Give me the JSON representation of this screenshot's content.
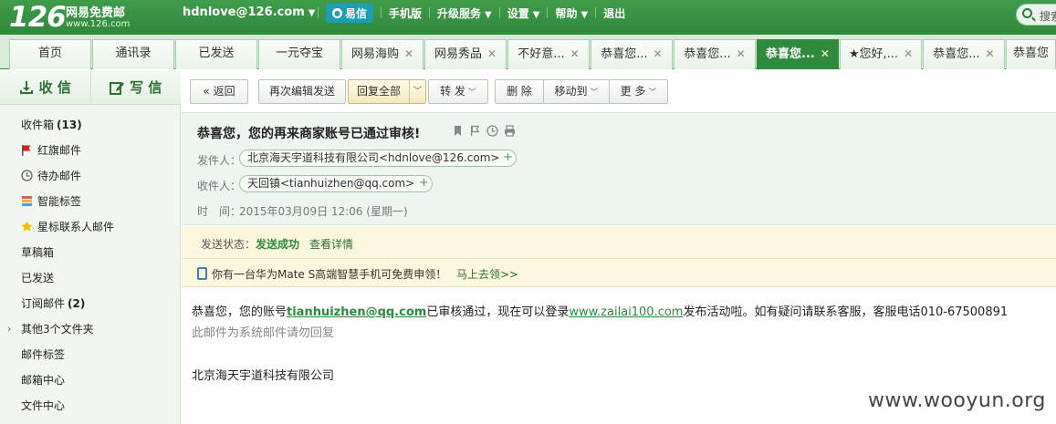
{
  "brand": {
    "logo": "126",
    "name": "网易免费邮",
    "url": "www.126.com"
  },
  "user": {
    "email": "hdnlove@126.com"
  },
  "topnav": {
    "yixin": "易信",
    "mobile": "手机版",
    "upgrade": "升级服务",
    "settings": "设置",
    "help": "帮助",
    "logout": "退出"
  },
  "search": {
    "placeholder": "搜索"
  },
  "tabs": [
    {
      "label": "首页"
    },
    {
      "label": "通讯录"
    },
    {
      "label": "已发送"
    },
    {
      "label": "一元夺宝"
    },
    {
      "label": "网易海购"
    },
    {
      "label": "网易秀品"
    },
    {
      "label": "不好意..."
    },
    {
      "label": "恭喜您..."
    },
    {
      "label": "恭喜您..."
    },
    {
      "label": "恭喜您..."
    },
    {
      "label": "★您好,..."
    },
    {
      "label": "恭喜您..."
    },
    {
      "label": "恭喜您"
    }
  ],
  "sidebar": {
    "receive": "收 信",
    "compose": "写 信",
    "folders": [
      {
        "label": "收件箱",
        "count": "(13)"
      },
      {
        "label": "红旗邮件"
      },
      {
        "label": "待办邮件"
      },
      {
        "label": "智能标签"
      },
      {
        "label": "星标联系人邮件"
      },
      {
        "label": "草稿箱"
      },
      {
        "label": "已发送"
      },
      {
        "label": "订阅邮件",
        "count": "(2)"
      },
      {
        "label": "其他3个文件夹"
      },
      {
        "label": "邮件标签"
      },
      {
        "label": "邮箱中心"
      },
      {
        "label": "文件中心"
      }
    ]
  },
  "toolbar": {
    "back": "返回",
    "reedit": "再次编辑发送",
    "reply_all": "回复全部",
    "forward": "转 发",
    "delete": "删 除",
    "move": "移动到",
    "more": "更 多"
  },
  "message": {
    "subject": "恭喜您，您的再来商家账号已通过审核!",
    "from_label": "发件人：",
    "from": "北京海天宇道科技有限公司<hdnlove@126.com>",
    "to_label": "收件人：",
    "to": "天回镇<tianhuizhen@qq.com>",
    "time_label": "时　间：",
    "time": "2015年03月09日 12:06 (星期一)",
    "status_label": "发送状态：",
    "status": "发送成功",
    "status_link": "查看详情",
    "promo": "你有一台华为Mate S高端智慧手机可免费申领！",
    "promo_link": "马上去领>>",
    "body_pre": "恭喜您，您的账号",
    "body_account": "tianhuizhen@qq.com",
    "body_mid": "已审核通过，现在可以登录",
    "body_site": "www.zailai100.com",
    "body_post": "发布活动啦。如有疑问请联系客服，客服电话010-67500891",
    "body_note": "此邮件为系统邮件请勿回复",
    "signature": "北京海天宇道科技有限公司"
  },
  "watermark": "www.wooyun.org",
  "colors": {
    "brand_green": "#2f8a3c",
    "link_green": "#2f8a3c",
    "status_bg": "#fbf7dc"
  }
}
